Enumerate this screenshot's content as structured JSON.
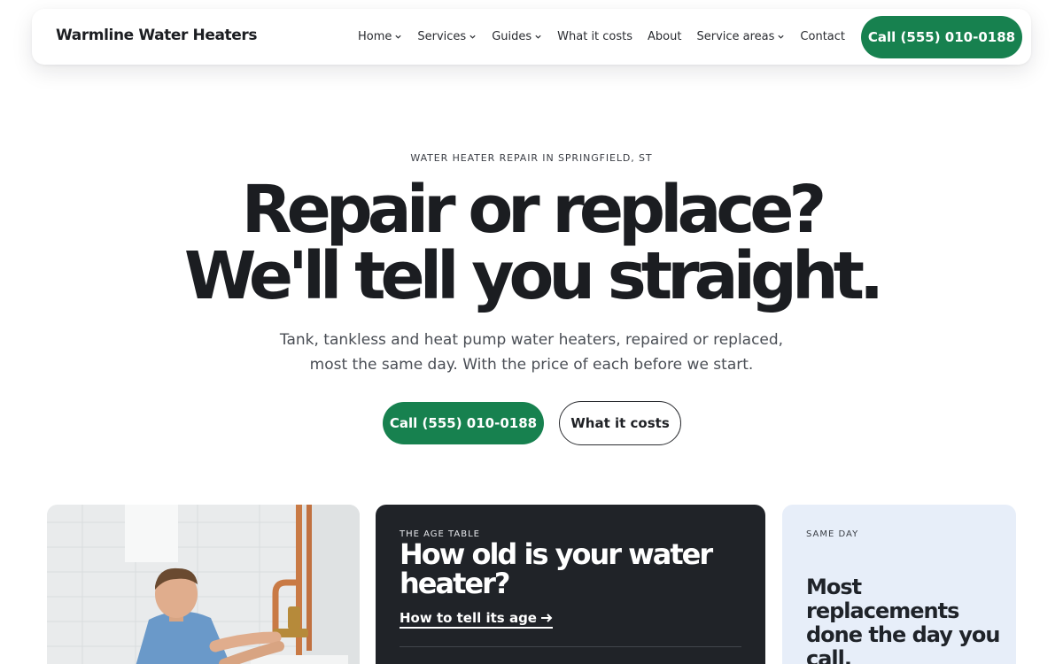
{
  "nav": {
    "brand": "Warmline Water Heaters",
    "items": [
      {
        "label": "Home",
        "dropdown": true
      },
      {
        "label": "Services",
        "dropdown": true
      },
      {
        "label": "Guides",
        "dropdown": true
      },
      {
        "label": "What it costs",
        "dropdown": false
      },
      {
        "label": "About",
        "dropdown": false
      },
      {
        "label": "Service areas",
        "dropdown": true
      },
      {
        "label": "Contact",
        "dropdown": false
      }
    ],
    "call_label": "Call (555) 010-0188"
  },
  "hero": {
    "eyebrow": "WATER HEATER REPAIR IN SPRINGFIELD, ST",
    "headline_line1": "Repair or replace?",
    "headline_line2": "We'll tell you straight.",
    "subtitle": "Tank, tankless and heat pump water heaters, repaired or replaced, most the same day. With the price of each before we start.",
    "primary_button": "Call (555) 010-0188",
    "secondary_button": "What it costs"
  },
  "cards": {
    "age": {
      "eyebrow": "THE AGE TABLE",
      "title": "How old is your water heater?",
      "link": "How to tell its age",
      "link_icon": "arrow-right-icon"
    },
    "same_day": {
      "eyebrow": "SAME DAY",
      "title": "Most replacements done the day you call."
    }
  },
  "colors": {
    "accent": "#17814f",
    "dark_card": "#202328",
    "light_card": "#e7eef9",
    "text": "#1f2125"
  }
}
